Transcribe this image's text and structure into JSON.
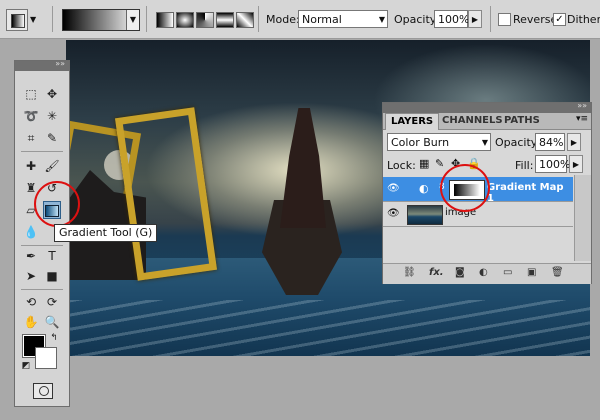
{
  "options_bar": {
    "mode_label": "Mode:",
    "mode_value": "Normal",
    "opacity_label": "Opacity:",
    "opacity_value": "100%",
    "reverse_label": "Reverse",
    "reverse_checked": false,
    "dither_label": "Dither",
    "dither_checked": true
  },
  "toolbox": {
    "tooltip": "Gradient Tool (G)",
    "foreground_color": "#000000",
    "background_color": "#ffffff"
  },
  "layers_panel": {
    "tabs": [
      "LAYERS",
      "CHANNELS",
      "PATHS"
    ],
    "active_tab": "LAYERS",
    "blend_mode": "Color Burn",
    "opacity_label": "Opacity:",
    "opacity_value": "84%",
    "lock_label": "Lock:",
    "fill_label": "Fill:",
    "fill_value": "100%",
    "layers": [
      {
        "name": "Gradient Map 1",
        "selected": true
      },
      {
        "name": "image",
        "selected": false
      }
    ],
    "footer_fx": "fx."
  },
  "colors": {
    "selection_blue": "#3d8ee3",
    "annotation_red": "#dd1111",
    "frame_gold": "#c9a22a"
  }
}
